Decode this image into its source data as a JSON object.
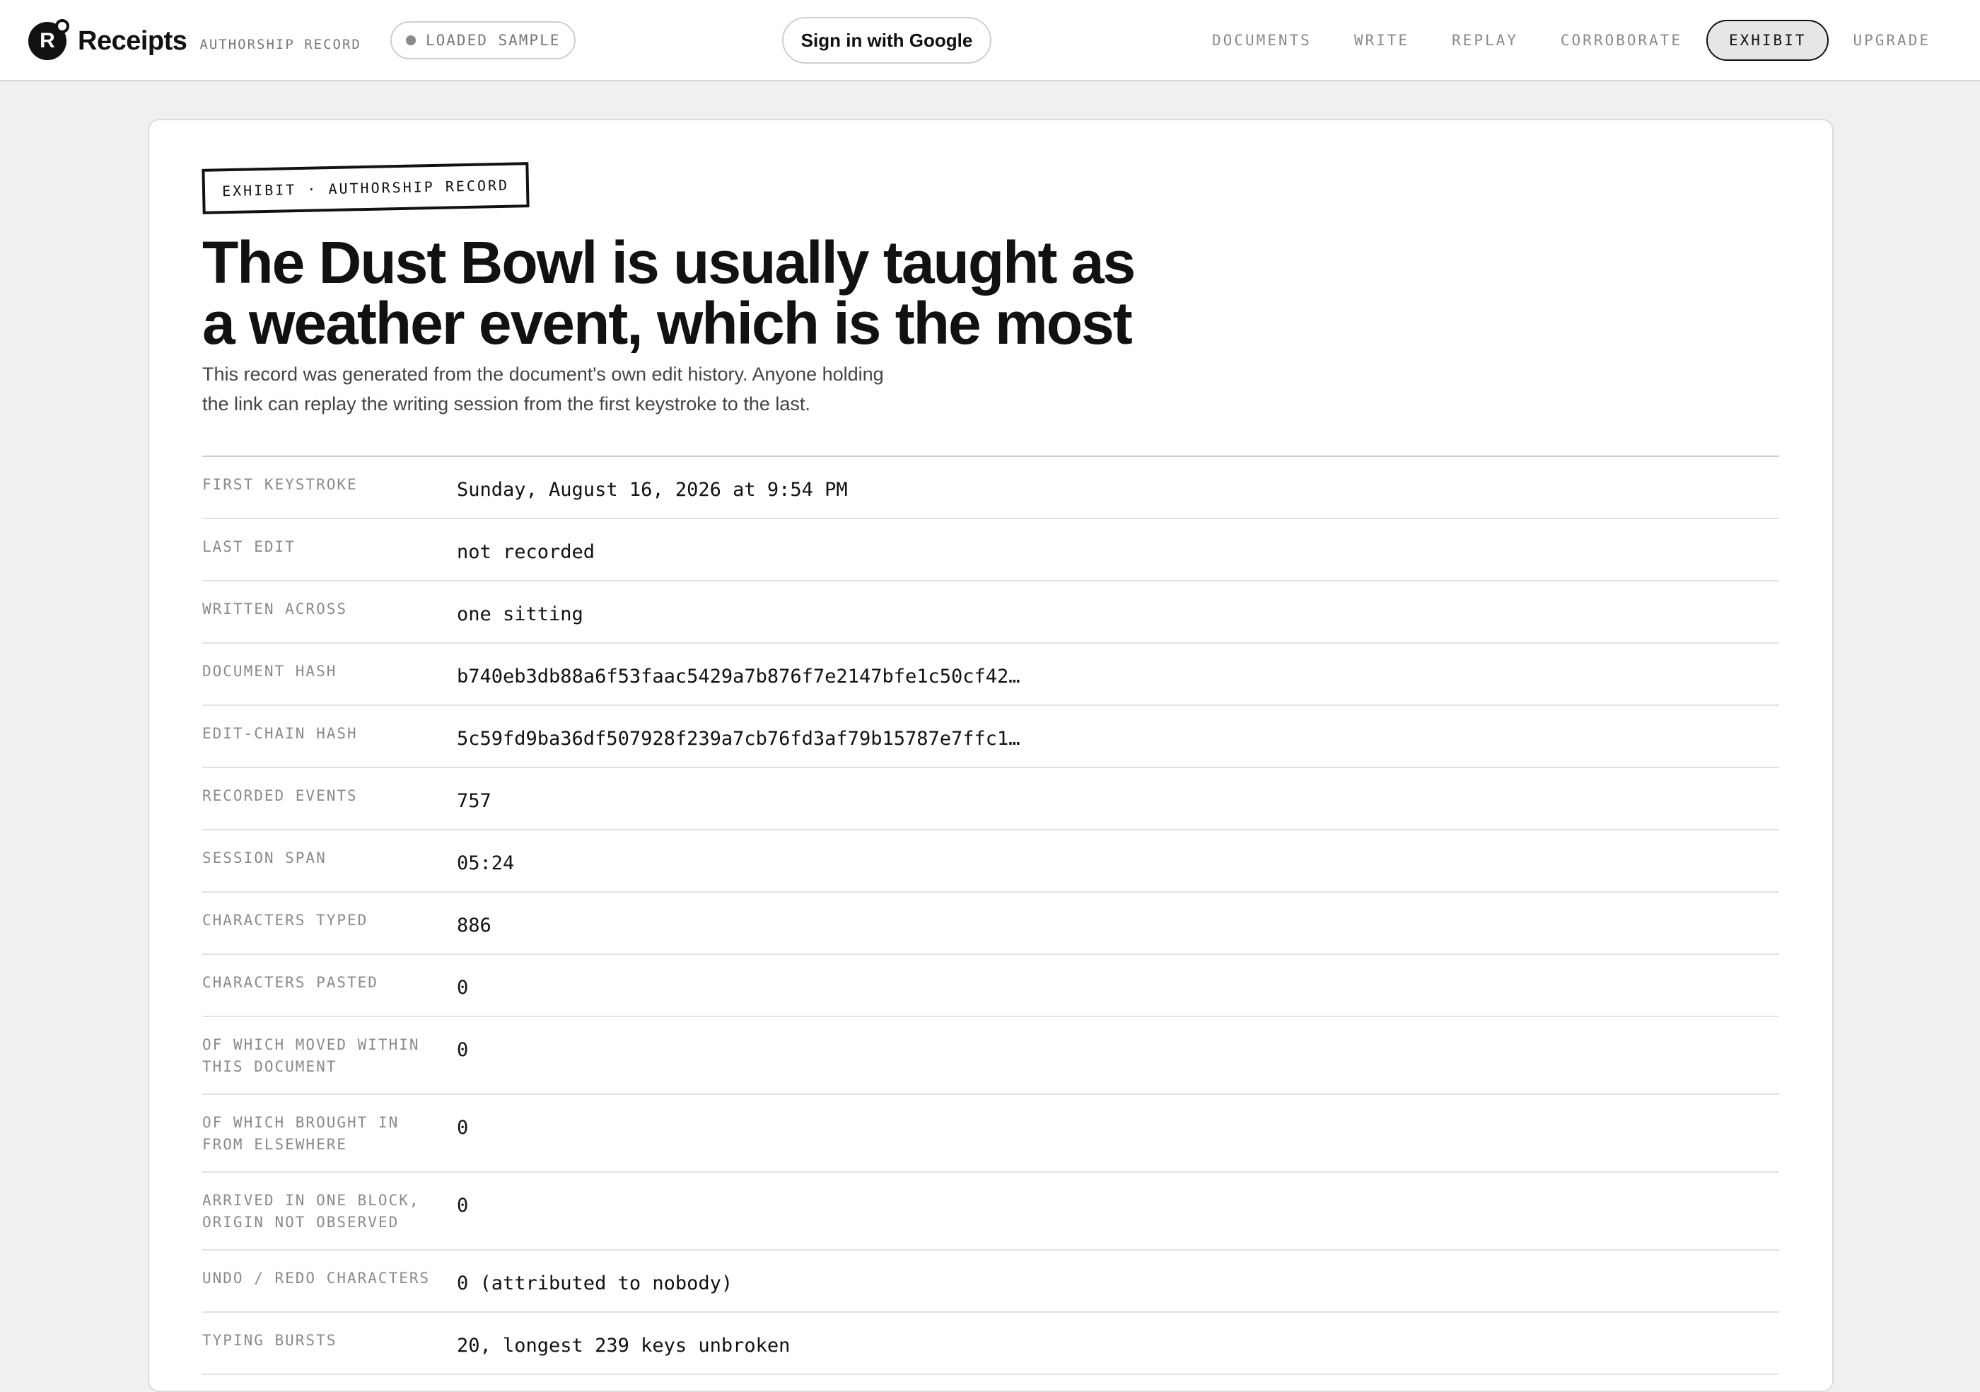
{
  "brand": {
    "logo_letter": "R",
    "name": "Receipts",
    "subtitle": "AUTHORSHIP RECORD"
  },
  "sample_pill": {
    "label": "LOADED SAMPLE"
  },
  "auth": {
    "google_button": "Sign in with Google"
  },
  "nav": {
    "items": [
      {
        "label": "DOCUMENTS",
        "active": false
      },
      {
        "label": "WRITE",
        "active": false
      },
      {
        "label": "REPLAY",
        "active": false
      },
      {
        "label": "CORROBORATE",
        "active": false
      },
      {
        "label": "EXHIBIT",
        "active": true
      },
      {
        "label": "UPGRADE",
        "active": false
      }
    ]
  },
  "exhibit": {
    "stamp": "EXHIBIT · AUTHORSHIP RECORD",
    "title": "The Dust Bowl is usually taught as a weather event, which is the most",
    "description": "This record was generated from the document's own edit history. Anyone holding the link can replay the writing session from the first keystroke to the last.",
    "rows": [
      {
        "label": "FIRST KEYSTROKE",
        "value": "Sunday, August 16, 2026 at 9:54 PM"
      },
      {
        "label": "LAST EDIT",
        "value": "not recorded"
      },
      {
        "label": "WRITTEN ACROSS",
        "value": "one sitting"
      },
      {
        "label": "DOCUMENT HASH",
        "value": "b740eb3db88a6f53faac5429a7b876f7e2147bfe1c50cf42…"
      },
      {
        "label": "EDIT-CHAIN HASH",
        "value": "5c59fd9ba36df507928f239a7cb76fd3af79b15787e7ffc1…"
      },
      {
        "label": "RECORDED EVENTS",
        "value": "757"
      },
      {
        "label": "SESSION SPAN",
        "value": "05:24"
      },
      {
        "label": "CHARACTERS TYPED",
        "value": "886"
      },
      {
        "label": "CHARACTERS PASTED",
        "value": "0"
      },
      {
        "label": "OF WHICH MOVED WITHIN THIS DOCUMENT",
        "value": "0"
      },
      {
        "label": "OF WHICH BROUGHT IN FROM ELSEWHERE",
        "value": "0"
      },
      {
        "label": "ARRIVED IN ONE BLOCK, ORIGIN NOT OBSERVED",
        "value": "0"
      },
      {
        "label": "UNDO / REDO CHARACTERS",
        "value": "0 (attributed to nobody)"
      },
      {
        "label": "TYPING BURSTS",
        "value": "20, longest 239 keys unbroken"
      }
    ]
  }
}
